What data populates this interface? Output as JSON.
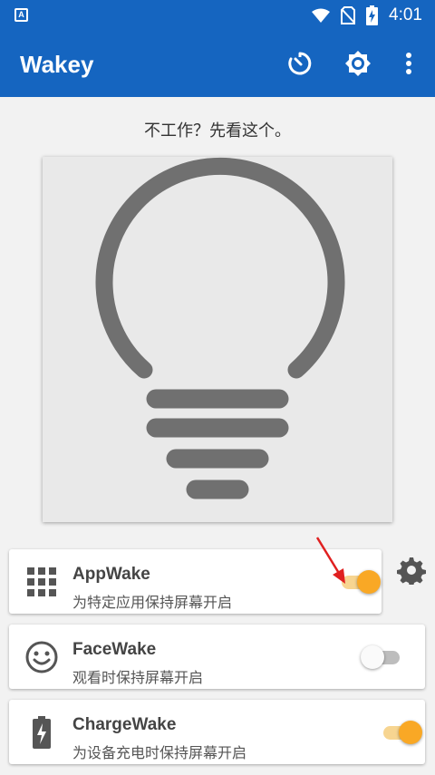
{
  "status_bar": {
    "time": "4:01",
    "app_badge": "A"
  },
  "app_bar": {
    "title": "Wakey",
    "accent": "#1565c0"
  },
  "hint": "不工作？先看这个。",
  "features": [
    {
      "name": "AppWake",
      "description": "为特定应用保持屏幕开启",
      "enabled": true
    },
    {
      "name": "FaceWake",
      "description": "观看时保持屏幕开启",
      "enabled": false
    },
    {
      "name": "ChargeWake",
      "description": "为设备充电时保持屏幕开启",
      "enabled": true
    }
  ],
  "colors": {
    "toggle_on": "#f9a825",
    "toggle_off": "#fafafa",
    "bulb": "#707070"
  }
}
